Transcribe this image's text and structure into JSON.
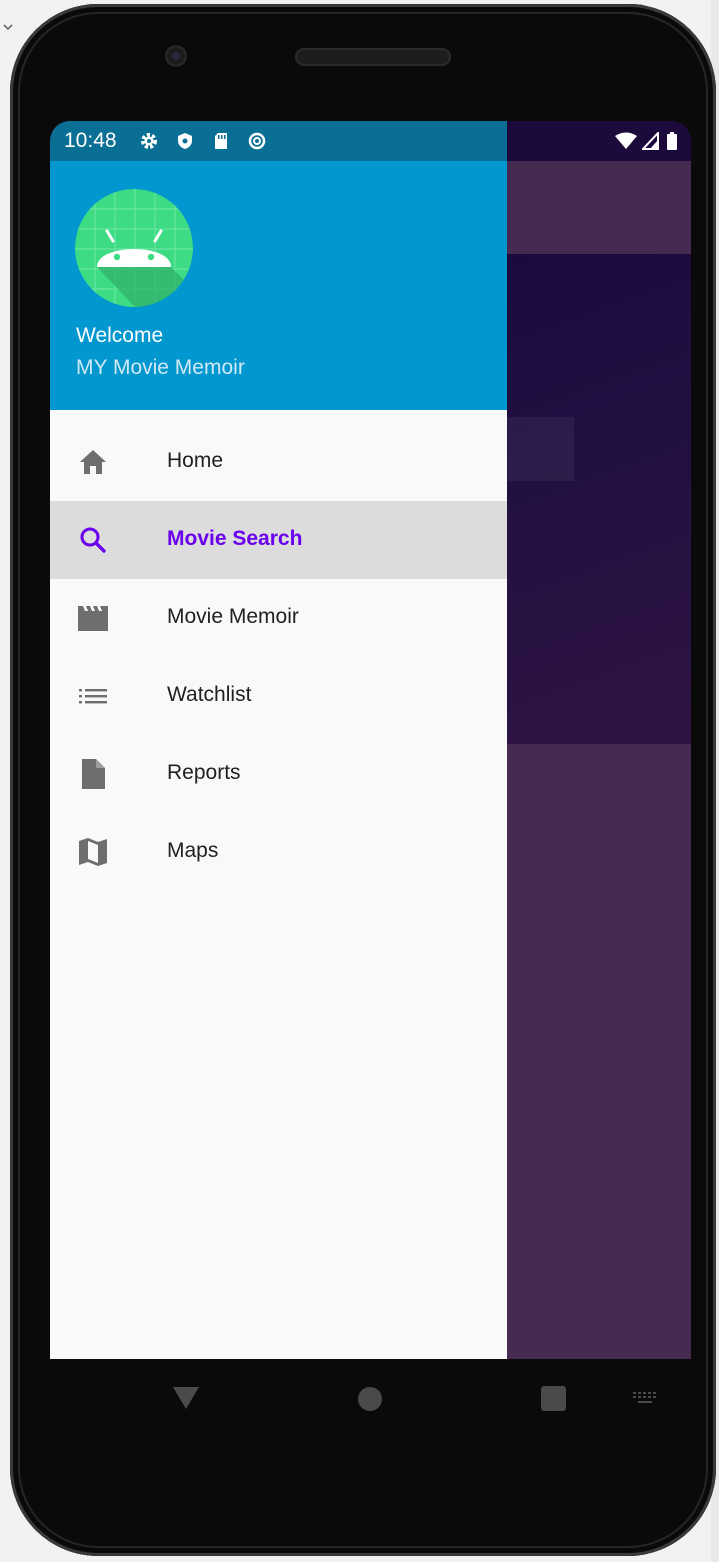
{
  "status_bar": {
    "time": "10:48",
    "left_icons": [
      "gear-icon",
      "shield-icon",
      "sd-card-icon",
      "sync-circle-icon"
    ],
    "right_icons": [
      "wifi-icon",
      "signal-icon",
      "battery-icon"
    ]
  },
  "drawer": {
    "header": {
      "avatar_icon": "android-icon",
      "welcome": "Welcome",
      "subtitle": "MY Movie Memoir"
    },
    "items": [
      {
        "label": "Home",
        "icon": "home-icon",
        "active": false
      },
      {
        "label": "Movie Search",
        "icon": "search-icon",
        "active": true
      },
      {
        "label": "Movie Memoir",
        "icon": "movie-clapper-icon",
        "active": false
      },
      {
        "label": "Watchlist",
        "icon": "list-icon",
        "active": false
      },
      {
        "label": "Reports",
        "icon": "document-icon",
        "active": false
      },
      {
        "label": "Maps",
        "icon": "map-icon",
        "active": false
      }
    ]
  },
  "nav_bar": {
    "buttons": [
      "back-icon",
      "home-circle-icon",
      "recents-icon",
      "keyboard-icon"
    ]
  },
  "colors": {
    "drawer_header": "#0297ce",
    "status_bar_left": "#0a6f95",
    "active_item_text": "#6a00ee",
    "active_item_bg": "#dcdcdc",
    "app_background": "#452a52"
  }
}
